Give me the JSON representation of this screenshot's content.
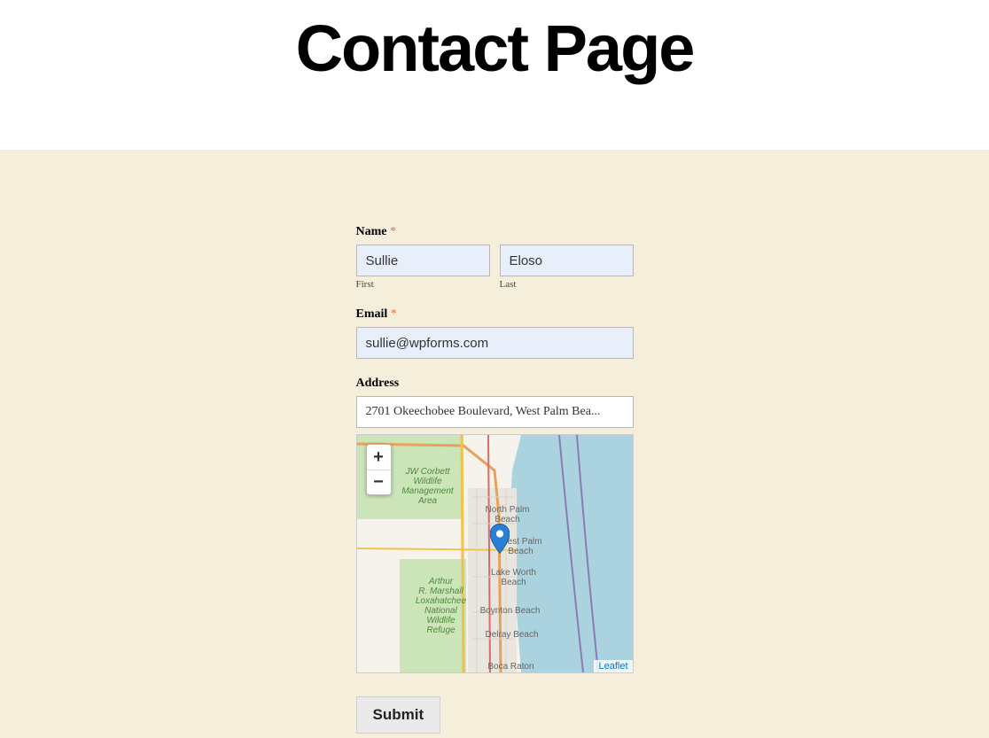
{
  "page": {
    "title": "Contact Page"
  },
  "form": {
    "name": {
      "label": "Name",
      "required_marker": "*",
      "first": {
        "value": "Sullie",
        "sublabel": "First"
      },
      "last": {
        "value": "Eloso",
        "sublabel": "Last"
      }
    },
    "email": {
      "label": "Email",
      "required_marker": "*",
      "value": "sullie@wpforms.com"
    },
    "address": {
      "label": "Address",
      "value": "2701 Okeechobee Boulevard, West Palm Bea..."
    },
    "submit_label": "Submit"
  },
  "map": {
    "zoom_in": "+",
    "zoom_out": "−",
    "attribution": "Leaflet",
    "labels": {
      "jw_corbett": "JW Corbett\nWildlife\nManagement\nArea",
      "loxahatchee": "Arthur\nR. Marshall\nLoxahatchee\nNational\nWildlife\nRefuge",
      "north_palm": "North Palm\nBeach",
      "west_palm": "West Palm\nBeach",
      "lake_worth": "Lake Worth\nBeach",
      "boynton": "Boynton Beach",
      "delray": "Delray Beach",
      "boca": "Boca Raton"
    }
  }
}
